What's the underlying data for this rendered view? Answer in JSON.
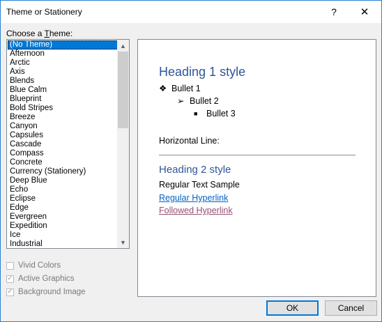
{
  "window": {
    "title": "Theme or Stationery",
    "help_glyph": "?",
    "close_glyph": "✕"
  },
  "themes": {
    "label_prefix": "Choose a ",
    "label_accel": "T",
    "label_suffix": "heme:",
    "items": [
      "(No Theme)",
      "Afternoon",
      "Arctic",
      "Axis",
      "Blends",
      "Blue Calm",
      "Blueprint",
      "Bold Stripes",
      "Breeze",
      "Canyon",
      "Capsules",
      "Cascade",
      "Compass",
      "Concrete",
      "Currency (Stationery)",
      "Deep Blue",
      "Echo",
      "Eclipse",
      "Edge",
      "Evergreen",
      "Expedition",
      "Ice",
      "Industrial"
    ],
    "selected": "(No Theme)"
  },
  "options": {
    "vivid_colors": "Vivid Colors",
    "active_graphics": "Active Graphics",
    "background_image": "Background Image"
  },
  "preview": {
    "heading1": "Heading 1 style",
    "bullet1": "Bullet 1",
    "bullet2": "Bullet 2",
    "bullet3": "Bullet 3",
    "hline_label": "Horizontal Line:",
    "heading2": "Heading 2 style",
    "regular_text": "Regular Text Sample",
    "hyperlink": "Regular Hyperlink",
    "followed_hyperlink": "Followed Hyperlink"
  },
  "buttons": {
    "ok": "OK",
    "cancel": "Cancel"
  }
}
